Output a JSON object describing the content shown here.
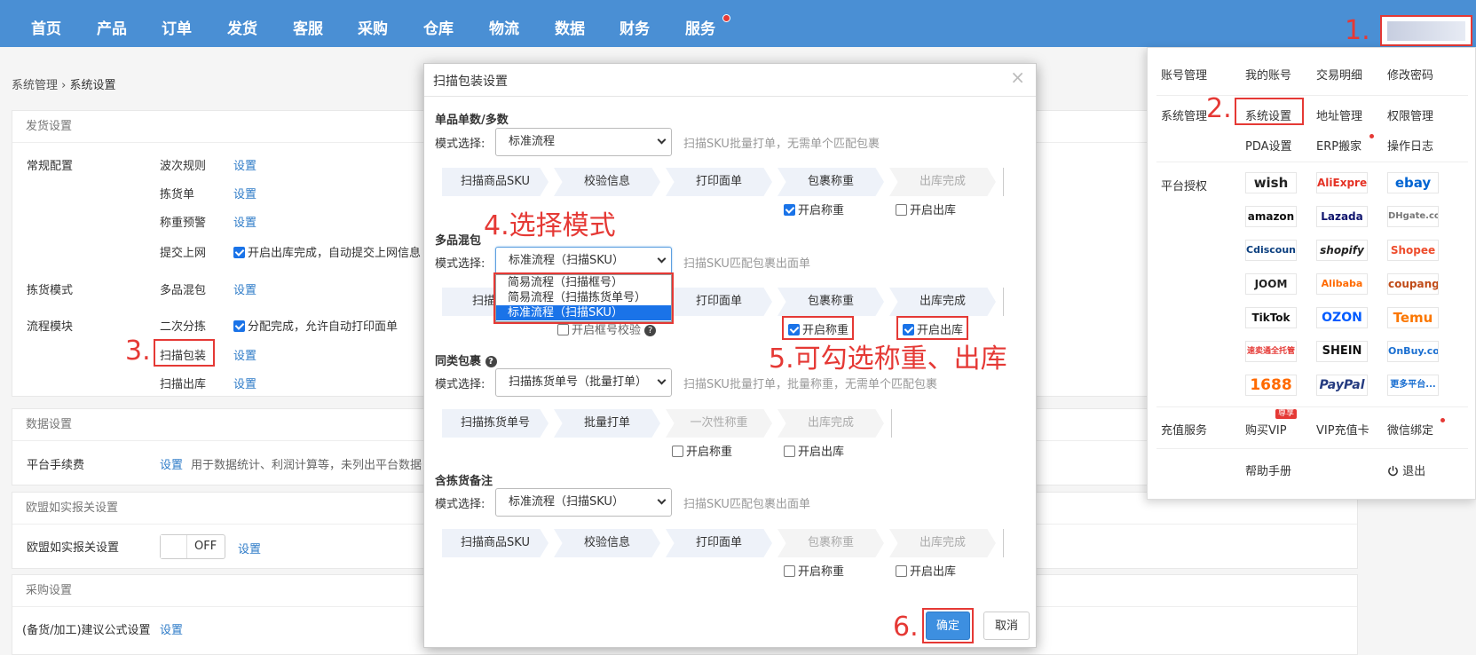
{
  "nav": {
    "items": [
      "首页",
      "产品",
      "订单",
      "发货",
      "客服",
      "采购",
      "仓库",
      "物流",
      "数据",
      "财务",
      "服务"
    ]
  },
  "annotations": {
    "a1": "1.",
    "a2": "2.",
    "a3": "3.",
    "a4": "4.选择模式",
    "a5": "5.可勾选称重、出库",
    "a6": "6."
  },
  "breadcrumb": {
    "parent": "系统管理",
    "sep": "›",
    "current": "系统设置"
  },
  "settings": {
    "ship_head": "发货设置",
    "general_config": "常规配置",
    "wave_rule": "波次规则",
    "pick_list": "拣货单",
    "weight_alert": "称重预警",
    "submit_online": "提交上网",
    "submit_online_desc": "开启出库完成，自动提交上网信息",
    "pick_mode": "拣货模式",
    "multi_mix": "多品混包",
    "flow_module": "流程模块",
    "second_sort": "二次分拣",
    "second_sort_desc": "分配完成，允许自动打印面单",
    "scan_pack": "扫描包装",
    "scan_out": "扫描出库",
    "set": "设置",
    "data_head": "数据设置",
    "platform_fee": "平台手续费",
    "platform_fee_desc": "用于数据统计、利润计算等，未列出平台数据",
    "eu_head": "欧盟如实报关设置",
    "eu_setting": "欧盟如实报关设置",
    "toggle_off": "OFF",
    "purchase_head": "采购设置",
    "formula": "(备货/加工)建议公式设置"
  },
  "modal": {
    "title": "扫描包装设置",
    "close": "×",
    "mode_label": "模式选择:",
    "s1": {
      "title": "单品单数/多数",
      "select": "标准流程",
      "hint": "扫描SKU批量打单，无需单个匹配包裹",
      "steps": [
        "扫描商品SKU",
        "校验信息",
        "打印面单",
        "包裹称重",
        "出库完成"
      ],
      "weigh_label": "开启称重",
      "out_label": "开启出库"
    },
    "s2": {
      "title": "多品混包",
      "select": "标准流程（扫描SKU）",
      "hint": "扫描SKU匹配包裹出面单",
      "dropdown": [
        "简易流程（扫描框号）",
        "简易流程（扫描拣货单号）",
        "标准流程（扫描SKU）"
      ],
      "steps": [
        "扫描商品",
        "打印面单",
        "包裹称重",
        "出库完成"
      ],
      "frame_check": "开启框号校验",
      "weigh_label": "开启称重",
      "out_label": "开启出库"
    },
    "s3": {
      "title": "同类包裹",
      "select": "扫描拣货单号（批量打单）",
      "hint": "扫描SKU批量打单，批量称重，无需单个匹配包裹",
      "steps": [
        "扫描拣货单号",
        "批量打单",
        "一次性称重",
        "出库完成"
      ],
      "weigh_label": "开启称重",
      "out_label": "开启出库"
    },
    "s4": {
      "title": "含拣货备注",
      "select": "标准流程（扫描SKU）",
      "hint": "扫描SKU匹配包裹出面单",
      "steps": [
        "扫描商品SKU",
        "校验信息",
        "打印面单",
        "包裹称重",
        "出库完成"
      ],
      "weigh_label": "开启称重",
      "out_label": "开启出库"
    },
    "ok": "确定",
    "cancel": "取消"
  },
  "menu": {
    "account_head": "账号管理",
    "my_account": "我的账号",
    "trade_detail": "交易明细",
    "change_pwd": "修改密码",
    "system_head": "系统管理",
    "system_settings": "系统设置",
    "address_mgmt": "地址管理",
    "perm_mgmt": "权限管理",
    "pda_settings": "PDA设置",
    "erp_move": "ERP搬家",
    "op_log": "操作日志",
    "platform_head": "平台授权",
    "platforms": [
      "wish",
      "AliExpress",
      "ebay",
      "amazon",
      "Lazada",
      "DHgate.com",
      "Cdiscount",
      "shopify",
      "Shopee",
      "JOOM",
      "Alibaba",
      "coupang",
      "TikTok",
      "OZON",
      "Temu",
      "速卖通全托管",
      "SHEIN",
      "OnBuy.com",
      "1688",
      "PayPal",
      "更多平台..."
    ],
    "recharge_head": "充值服务",
    "buy_vip": "购买VIP",
    "vip_badge": "尊享",
    "vip_card": "VIP充值卡",
    "wechat_bind": "微信绑定",
    "help": "帮助手册",
    "logout": "退出"
  },
  "colors": {
    "nav_bg": "#4a8fd4",
    "accent": "#2f7cc8",
    "annotation_red": "#e53935"
  }
}
